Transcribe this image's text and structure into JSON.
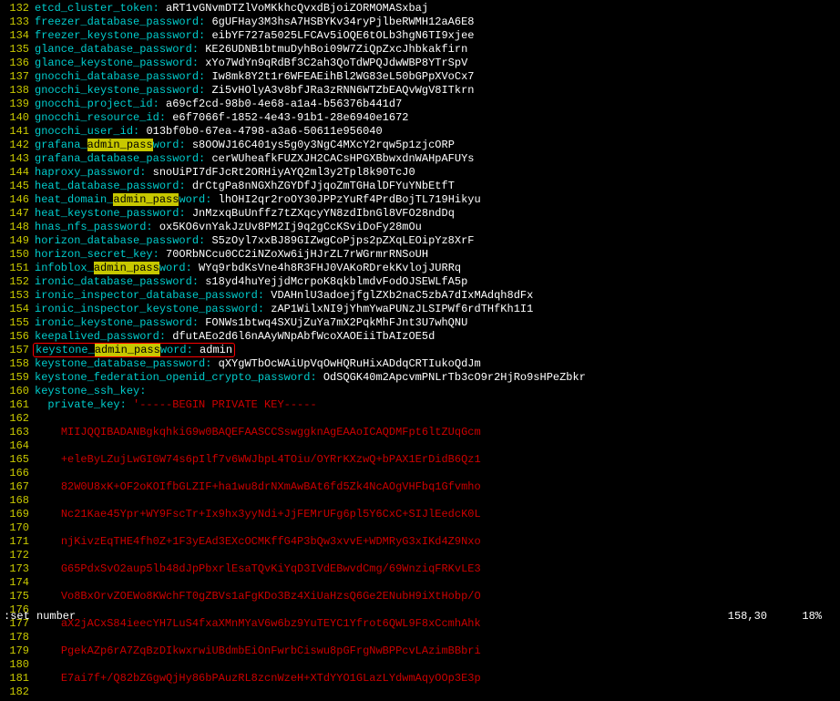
{
  "highlight_term": "admin_pass",
  "lines": [
    {
      "n": 132,
      "type": "kv",
      "key": "etcd_cluster_token",
      "val": "aRT1vGNvmDTZlVoMKkhcQvxdBjoiZORMOMASxbaj"
    },
    {
      "n": 133,
      "type": "kv",
      "key": "freezer_database_password",
      "val": "6gUFHay3M3hsA7HSBYKv34ryPjlbeRWMH12aA6E8"
    },
    {
      "n": 134,
      "type": "kv",
      "key": "freezer_keystone_password",
      "val": "eibYF727a5025LFCAv5iOQE6tOLb3hgN6TI9xjee"
    },
    {
      "n": 135,
      "type": "kv",
      "key": "glance_database_password",
      "val": "KE26UDNB1btmuDyhBoi09W7ZiQpZxcJhbkakfirn"
    },
    {
      "n": 136,
      "type": "kv",
      "key": "glance_keystone_password",
      "val": "xYo7WdYn9qRdBf3C2ah3QoTdWPQJdwWBP8YTrSpV"
    },
    {
      "n": 137,
      "type": "kv",
      "key": "gnocchi_database_password",
      "val": "Iw8mk8Y2t1r6WFEAEihBl2WG83eL50bGPpXVoCx7"
    },
    {
      "n": 138,
      "type": "kv",
      "key": "gnocchi_keystone_password",
      "val": "Zi5vHOlyA3v8bfJRa3zRNN6WTZbEAQvWgV8ITkrn"
    },
    {
      "n": 139,
      "type": "kv",
      "key": "gnocchi_project_id",
      "val": "a69cf2cd-98b0-4e68-a1a4-b56376b441d7"
    },
    {
      "n": 140,
      "type": "kv",
      "key": "gnocchi_resource_id",
      "val": "e6f7066f-1852-4e43-91b1-28e6940e1672"
    },
    {
      "n": 141,
      "type": "kv",
      "key": "gnocchi_user_id",
      "val": "013bf0b0-67ea-4798-a3a6-50611e956040"
    },
    {
      "n": 142,
      "type": "kvh",
      "pre": "grafana_",
      "mid": "admin_pass",
      "post": "word",
      "val": "s8OOWJ16C401ys5g0y3NgC4MXcY2rqw5p1zjcORP"
    },
    {
      "n": 143,
      "type": "kv",
      "key": "grafana_database_password",
      "val": "cerWUheafkFUZXJH2CACsHPGXBbwxdnWAHpAFUYs"
    },
    {
      "n": 144,
      "type": "kv",
      "key": "haproxy_password",
      "val": "snoUiPI7dFJcRt2ORHiyAYQ2ml3y2Tpl8k90TcJ0"
    },
    {
      "n": 145,
      "type": "kv",
      "key": "heat_database_password",
      "val": "drCtgPa8nNGXhZGYDfJjqoZmTGHalDFYuYNbEtfT"
    },
    {
      "n": 146,
      "type": "kvh",
      "pre": "heat_domain_",
      "mid": "admin_pass",
      "post": "word",
      "val": "lhOHI2qr2roOY30JPPzYuRf4PrdBojTL719Hikyu"
    },
    {
      "n": 147,
      "type": "kv",
      "key": "heat_keystone_password",
      "val": "JnMzxqBuUnffz7tZXqcyYN8zdIbnGl8VFO28ndDq"
    },
    {
      "n": 148,
      "type": "kv",
      "key": "hnas_nfs_password",
      "val": "ox5KO6vnYakJzUv8PM2Ij9q2gCcKSviDoFy28mOu"
    },
    {
      "n": 149,
      "type": "kv",
      "key": "horizon_database_password",
      "val": "S5zOyl7xxBJ89GIZwgCoPjps2pZXqLEOipYz8XrF"
    },
    {
      "n": 150,
      "type": "kv",
      "key": "horizon_secret_key",
      "val": "70ORbNCcu0CC2iNZoXw6ijHJrZL7rWGrmrRNSoUH"
    },
    {
      "n": 151,
      "type": "kvh",
      "pre": "infoblox_",
      "mid": "admin_pass",
      "post": "word",
      "val": "WYq9rbdKsVne4h8R3FHJ0VAKoRDrekKvlojJURRq"
    },
    {
      "n": 152,
      "type": "kv",
      "key": "ironic_database_password",
      "val": "s18yd4huYejjdMcrpoK8qkblmdvFodOJSEWLfA5p"
    },
    {
      "n": 153,
      "type": "kv",
      "key": "ironic_inspector_database_password",
      "val": "VDAHnlU3adoejfglZXb2naC5zbA7dIxMAdqh8dFx"
    },
    {
      "n": 154,
      "type": "kv",
      "key": "ironic_inspector_keystone_password",
      "val": "zAP1WilxNI9jYhmYwaPUNzJLSIPWf6rdTHfKh1I1"
    },
    {
      "n": 155,
      "type": "kv",
      "key": "ironic_keystone_password",
      "val": "FONWs1btwq4SXUjZuYa7mX2PqkMhFJnt3U7whQNU"
    },
    {
      "n": 156,
      "type": "kv",
      "key": "keepalived_password",
      "val": "dfutAEo2d6l6nAAyWNpAbfWcoXAOEiiTbAIzOE5d"
    },
    {
      "n": 157,
      "type": "kvhbox",
      "pre": "keystone_",
      "mid": "admin_pass",
      "post": "word",
      "val": "admin"
    },
    {
      "n": 158,
      "type": "kv",
      "key": "keystone_database_password",
      "val": "qXYgWTbOcWAiUpVqOwHQRuHixADdqCRTIukoQdJm"
    },
    {
      "n": 159,
      "type": "kv",
      "key": "keystone_federation_openid_crypto_password",
      "val": "OdSQGK40m2ApcvmPNLrTb3cO9r2HjRo9sHPeZbkr"
    },
    {
      "n": 160,
      "type": "kv",
      "key": "keystone_ssh_key",
      "val": ""
    },
    {
      "n": 161,
      "type": "pk",
      "key": "private_key",
      "val": "'-----BEGIN PRIVATE KEY-----"
    },
    {
      "n": 162,
      "type": "empty"
    },
    {
      "n": 163,
      "type": "red",
      "val": "MIIJQQIBADANBgkqhkiG9w0BAQEFAASCCSswggknAgEAAoICAQDMFpt6ltZUqGcm"
    },
    {
      "n": 164,
      "type": "empty"
    },
    {
      "n": 165,
      "type": "red",
      "val": "+eleByLZujLwGIGW74s6pIlf7v6WWJbpL4TOiu/OYRrKXzwQ+bPAX1ErDidB6Qz1"
    },
    {
      "n": 166,
      "type": "empty"
    },
    {
      "n": 167,
      "type": "red",
      "val": "82W0U8xK+OF2oKOIfbGLZIF+ha1wu8drNXmAwBAt6fd5Zk4NcAOgVHFbq1Gfvmho"
    },
    {
      "n": 168,
      "type": "empty"
    },
    {
      "n": 169,
      "type": "red",
      "val": "Nc21Kae45Ypr+WY9FscTr+Ix9hx3yyNdi+JjFEMrUFg6pl5Y6CxC+SIJlEedcK0L"
    },
    {
      "n": 170,
      "type": "empty"
    },
    {
      "n": 171,
      "type": "red",
      "val": "njKivzEqTHE4fh0Z+1F3yEAd3EXcOCMKffG4P3bQw3xvvE+WDMRyG3xIKd4Z9Nxo"
    },
    {
      "n": 172,
      "type": "empty"
    },
    {
      "n": 173,
      "type": "red",
      "val": "G65PdxSvO2aup5lb48dJpPbxrlEsaTQvKiYqD3IVdEBwvdCmg/69WnziqFRKvLE3"
    },
    {
      "n": 174,
      "type": "empty"
    },
    {
      "n": 175,
      "type": "red",
      "val": "Vo8BxOrvZOEWo8KWchFT0gZBVs1aFgKDo3Bz4XiUaHzsQ6Ge2ENubH9iXtHobp/O"
    },
    {
      "n": 176,
      "type": "empty"
    },
    {
      "n": 177,
      "type": "red",
      "val": "aX2jACxS84ieecYH7LuS4fxaXMnMYaV6w6bz9YuTEYC1Yfrot6QWL9F8xCcmhAhk"
    },
    {
      "n": 178,
      "type": "empty"
    },
    {
      "n": 179,
      "type": "red",
      "val": "PgekAZp6rA7ZqBzDIkwxrwiUBdmbEiOnFwrbCiswu8pGFrgNwBPPcvLAzimBBbri"
    },
    {
      "n": 180,
      "type": "empty"
    },
    {
      "n": 181,
      "type": "red",
      "val": "E7ai7f+/Q82bZGgwQjHy86bPAuzRL8zcnWzeH+XTdYYO1GLazLYdwmAqyOOp3E3p"
    },
    {
      "n": 182,
      "type": "empty"
    }
  ],
  "status": {
    "command": ":set number",
    "position": "158,30",
    "percent": "18%"
  }
}
